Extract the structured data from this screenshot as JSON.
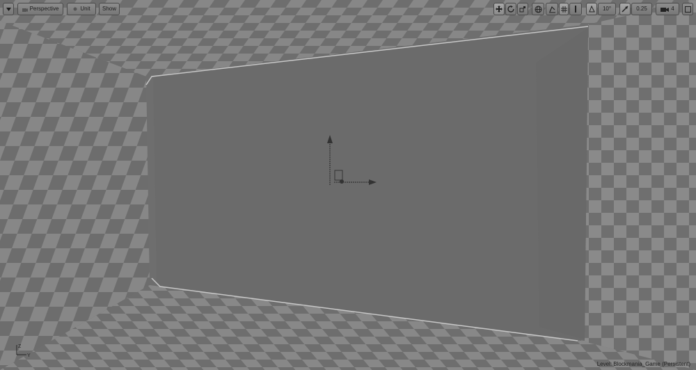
{
  "toolbar": {
    "menu_icon": "chevron-down-icon",
    "perspective_label": "Perspective",
    "lit_label": "Unit",
    "show_label": "Show",
    "grid_snap_angle_value": "10°",
    "scale_snap_value": "0.25",
    "camera_speed_value": "4"
  },
  "status": {
    "level_label": "Level:",
    "level_name": "Blockmania_Game (Persistent)"
  },
  "axis_indicator": {
    "z_label": "Z",
    "y_label": "Y"
  },
  "colors": {
    "viewport_bg": "#6e6e6e",
    "checker_light": "#8a8a8a",
    "checker_dark": "#707070",
    "wall_gray": "#6b6b6b",
    "edge_highlight": "#c8c8c8"
  }
}
